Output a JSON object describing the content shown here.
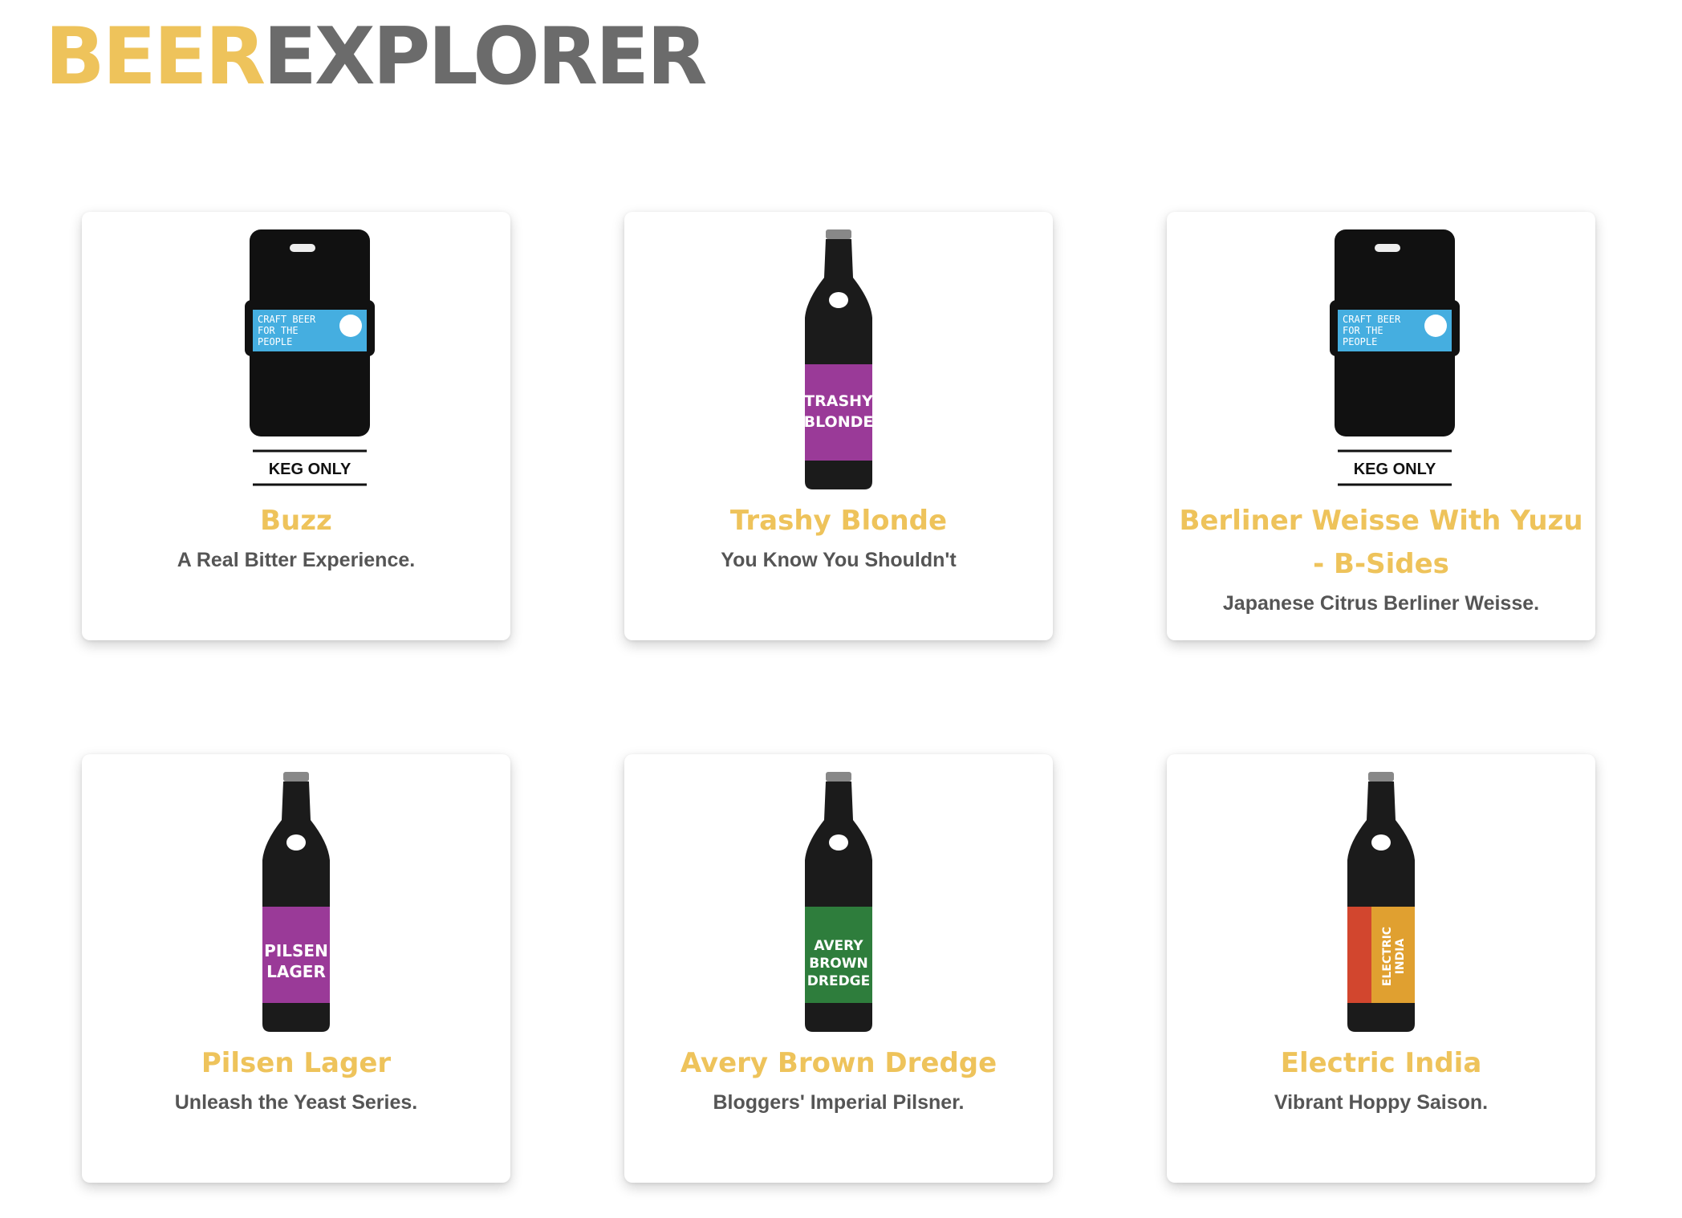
{
  "header": {
    "logo_part1": "BEER",
    "logo_part2": "EXPLORER"
  },
  "colors": {
    "accent": "#eec35b",
    "logo_grey": "#6b6b6b",
    "text": "#555555"
  },
  "beers": [
    {
      "name": "Buzz",
      "tagline": "A Real Bitter Experience.",
      "image": "keg",
      "label_color": "#45aee0",
      "label_text": [
        "CRAFT BEER",
        "FOR THE",
        "PEOPLE"
      ],
      "keg_label": "KEG ONLY"
    },
    {
      "name": "Trashy Blonde",
      "tagline": "You Know You Shouldn't",
      "image": "bottle",
      "label_color": "#9a3a98",
      "label_text": [
        "TRASHY",
        "BLONDE"
      ]
    },
    {
      "name": "Berliner Weisse With Yuzu - B-Sides",
      "tagline": "Japanese Citrus Berliner Weisse.",
      "image": "keg",
      "label_color": "#45aee0",
      "label_text": [
        "CRAFT BEER",
        "FOR THE",
        "PEOPLE"
      ],
      "keg_label": "KEG ONLY"
    },
    {
      "name": "Pilsen Lager",
      "tagline": "Unleash the Yeast Series.",
      "image": "bottle",
      "label_color": "#9a3a98",
      "label_text": [
        "PILSEN",
        "LAGER"
      ]
    },
    {
      "name": "Avery Brown Dredge",
      "tagline": "Bloggers' Imperial Pilsner.",
      "image": "bottle",
      "label_color": "#2e7d3c",
      "label_text": [
        "AVERY",
        "BROWN",
        "DREDGE"
      ]
    },
    {
      "name": "Electric India",
      "tagline": "Vibrant Hoppy Saison.",
      "image": "bottle",
      "label_color": "#e0a030",
      "label_text": [
        "ELECTRIC",
        "INDIA"
      ]
    }
  ]
}
